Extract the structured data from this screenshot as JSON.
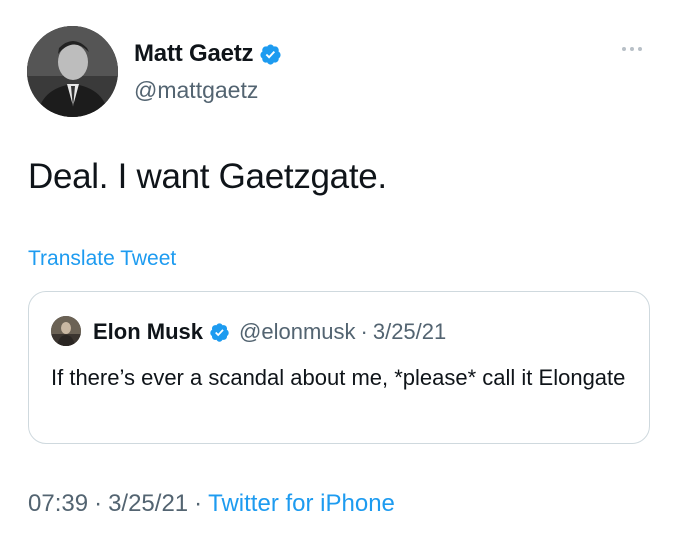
{
  "author": {
    "display_name": "Matt Gaetz",
    "handle": "@mattgaetz"
  },
  "tweet": {
    "text": "Deal. I want Gaetzgate.",
    "translate_label": "Translate Tweet"
  },
  "quoted_tweet": {
    "display_name": "Elon Musk",
    "handle": "@elonmusk",
    "separator": "·",
    "date": "3/25/21",
    "text": "If there’s ever a scandal about me, *please* call it Elongate"
  },
  "footer": {
    "time": "07:39",
    "separator": "·",
    "date": "3/25/21",
    "source": "Twitter for iPhone"
  },
  "icons": {
    "verified": "verified-badge-icon",
    "more": "more-options-icon"
  },
  "colors": {
    "verified": "#1d9bf0",
    "link": "#1d9bf0",
    "secondary_text": "#536471",
    "border": "#cfd9de"
  }
}
